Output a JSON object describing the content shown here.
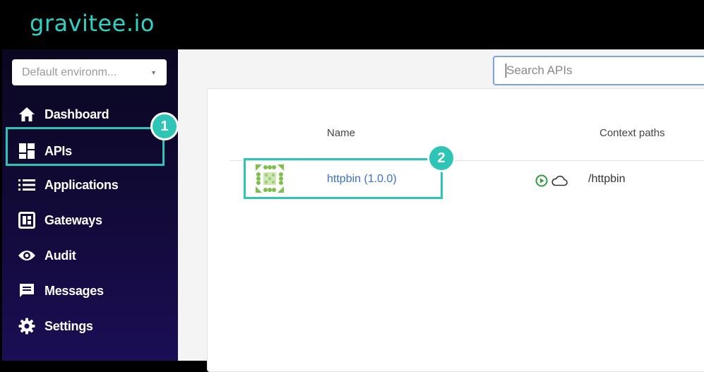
{
  "header": {
    "logo": "gravitee.io"
  },
  "sidebar": {
    "environment": {
      "value": "Default environm..."
    },
    "items": [
      {
        "label": "Dashboard",
        "icon": "home-icon"
      },
      {
        "label": "APIs",
        "icon": "apis-icon"
      },
      {
        "label": "Applications",
        "icon": "list-icon"
      },
      {
        "label": "Gateways",
        "icon": "gateway-icon"
      },
      {
        "label": "Audit",
        "icon": "eye-icon"
      },
      {
        "label": "Messages",
        "icon": "message-icon"
      },
      {
        "label": "Settings",
        "icon": "gear-icon"
      }
    ]
  },
  "search": {
    "placeholder": "Search APIs"
  },
  "table": {
    "headers": {
      "name": "Name",
      "context": "Context paths"
    },
    "rows": [
      {
        "name": "httpbin (1.0.0)",
        "context": "/httpbin",
        "status": [
          "started-icon",
          "cloud-icon"
        ]
      }
    ]
  },
  "annotations": {
    "badge1": "1",
    "badge2": "2"
  },
  "colors": {
    "accent": "#2ec4b6",
    "logo": "#2fd2c5",
    "link": "#3b6fc7",
    "started": "#2e9e3f"
  }
}
